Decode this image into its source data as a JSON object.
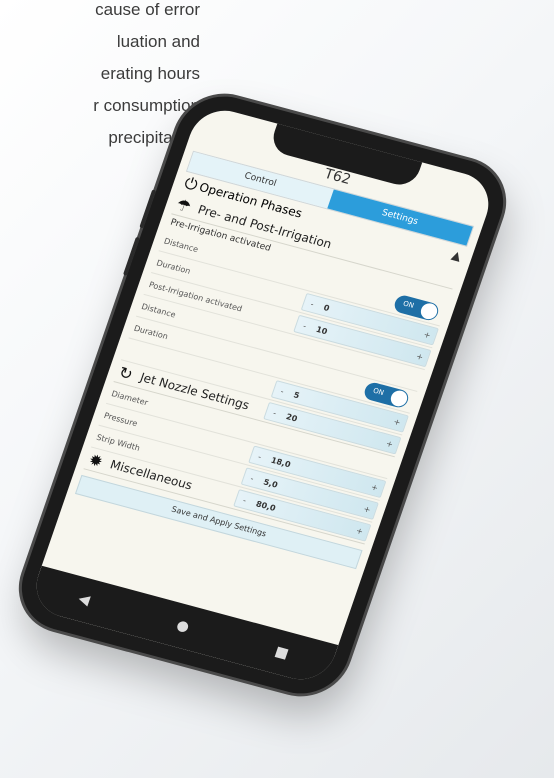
{
  "background_text": {
    "lines": [
      "cause of error",
      "luation and",
      "erating hours",
      "r consumption",
      "precipitation"
    ]
  },
  "app": {
    "title": "T62",
    "tabs": {
      "control": "Control",
      "settings": "Settings"
    },
    "sections": {
      "operation_phases": {
        "title": "Operation Phases",
        "icon": "power-icon"
      },
      "pre_post": {
        "title": "Pre- and Post-Irrigation",
        "icon": "watering-can-icon"
      },
      "jet_nozzle": {
        "title": "Jet Nozzle Settings",
        "icon": "nozzle-icon"
      },
      "misc": {
        "title": "Miscellaneous",
        "icon": "gear-icon"
      }
    },
    "pre_irrigation": {
      "label": "Pre-Irrigation activated",
      "toggle": "ON",
      "distance_label": "Distance",
      "distance_value": "0",
      "duration_label": "Duration",
      "duration_value": "10"
    },
    "post_irrigation": {
      "label": "Post-Irrigation activated",
      "toggle": "ON",
      "distance_label": "Distance",
      "distance_value": "5",
      "duration_label": "Duration",
      "duration_value": "20"
    },
    "nozzle": {
      "diameter_label": "Diameter",
      "diameter_value": "18,0",
      "pressure_label": "Pressure",
      "pressure_value": "5,0",
      "strip_width_label": "Strip Width",
      "strip_width_value": "80,0"
    },
    "stepper_minus": "-",
    "stepper_plus": "+",
    "save_button": "Save and Apply Settings"
  },
  "navbar": {
    "back": "◀",
    "home": "●",
    "recent": "■"
  },
  "colors": {
    "accent": "#2c9ddb",
    "toggle": "#1e6fa6"
  }
}
